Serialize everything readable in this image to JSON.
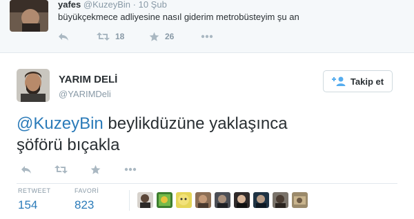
{
  "top_tweet": {
    "name": "yafes",
    "handle": "@KuzeyBin",
    "separator": "·",
    "date": "10 Şub",
    "text": "büyükçekmece adliyesine nasıl giderim metrobüsteyim şu an",
    "retweet_count": "18",
    "favorite_count": "26"
  },
  "main_tweet": {
    "name": "YARIM DELİ",
    "handle": "@YARIMDeli",
    "follow_label": "Takip et",
    "mention": "@KuzeyBin",
    "text_line1_rest": " beylikdüzüne yaklaşınca",
    "text_line2": "şöförü bıçakla",
    "retweet_label": "RETWEET",
    "retweet_value": "154",
    "favorite_label": "FAVORİ",
    "favorite_value": "823"
  },
  "colors": {
    "link": "#2b7bb9",
    "muted": "#8899a6",
    "text": "#292f33",
    "top_background": "#f5f8fa"
  },
  "icons": [
    "reply-icon",
    "retweet-icon",
    "favorite-star-icon",
    "more-icon",
    "follow-person-plus-icon"
  ]
}
